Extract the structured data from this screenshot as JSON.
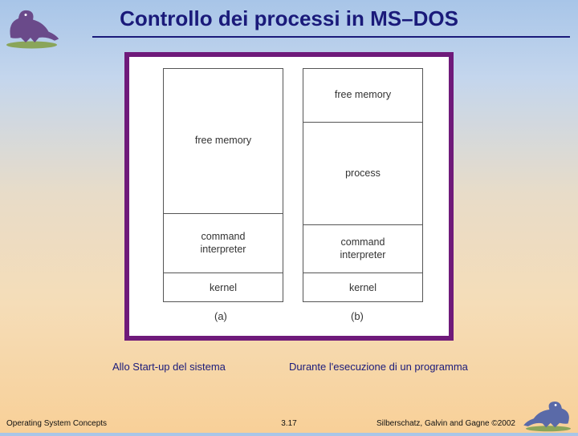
{
  "title": "Controllo dei processi in MS–DOS",
  "figure": {
    "col_a": {
      "segments": [
        {
          "label": "free memory",
          "h": 180
        },
        {
          "label": "command\ninterpreter",
          "h": 74
        },
        {
          "label": "kernel",
          "h": 38
        }
      ],
      "tag": "(a)"
    },
    "col_b": {
      "segments": [
        {
          "label": "free memory",
          "h": 66
        },
        {
          "label": "process",
          "h": 128
        },
        {
          "label": "command\ninterpreter",
          "h": 60
        },
        {
          "label": "kernel",
          "h": 38
        }
      ],
      "tag": "(b)"
    }
  },
  "captions": {
    "left": "Allo Start-up del sistema",
    "right": "Durante l'esecuzione di un programma"
  },
  "footer": {
    "left": "Operating System Concepts",
    "center": "3.17",
    "right": "Silberschatz, Galvin and Gagne ©2002"
  },
  "icons": {
    "dino_tl": "dinosaur-icon",
    "dino_br": "dinosaur-icon"
  }
}
